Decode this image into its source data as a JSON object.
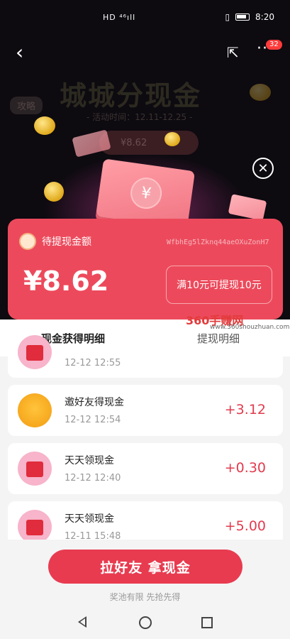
{
  "status_bar": {
    "signal": "HD ⁴⁶ıll",
    "time": "8:20"
  },
  "nav": {
    "back": "‹",
    "share": "⇱",
    "more": "···",
    "badge": "32"
  },
  "hero": {
    "title": "城城分现金",
    "date": "- 活动时间：12.11-12.25 -",
    "strategy": "攻略",
    "pill_text": "¥8.62"
  },
  "card": {
    "label": "待提现金额",
    "id": "WfbhEg5lZknq44aeOXuZonH7",
    "amount": "¥8.62",
    "pill": "满10元可提现10元"
  },
  "tabs": {
    "active": "现金获得明细",
    "inactive": "提现明细"
  },
  "watermark": {
    "brand": "360手赚网",
    "url": "www.360shouzhuan.com"
  },
  "list": [
    {
      "title": "",
      "time": "12-12 12:55",
      "amount": "",
      "icon": "envelope"
    },
    {
      "title": "邀好友得现金",
      "time": "12-12 12:54",
      "amount": "+3.12",
      "icon": "coin-bag"
    },
    {
      "title": "天天领现金",
      "time": "12-12 12:40",
      "amount": "+0.30",
      "icon": "envelope"
    },
    {
      "title": "天天领现金",
      "time": "12-11 15:48",
      "amount": "+5.00",
      "icon": "envelope"
    }
  ],
  "footer": {
    "cta": "拉好友 拿现金",
    "note": "奖池有限 先抢先得"
  }
}
